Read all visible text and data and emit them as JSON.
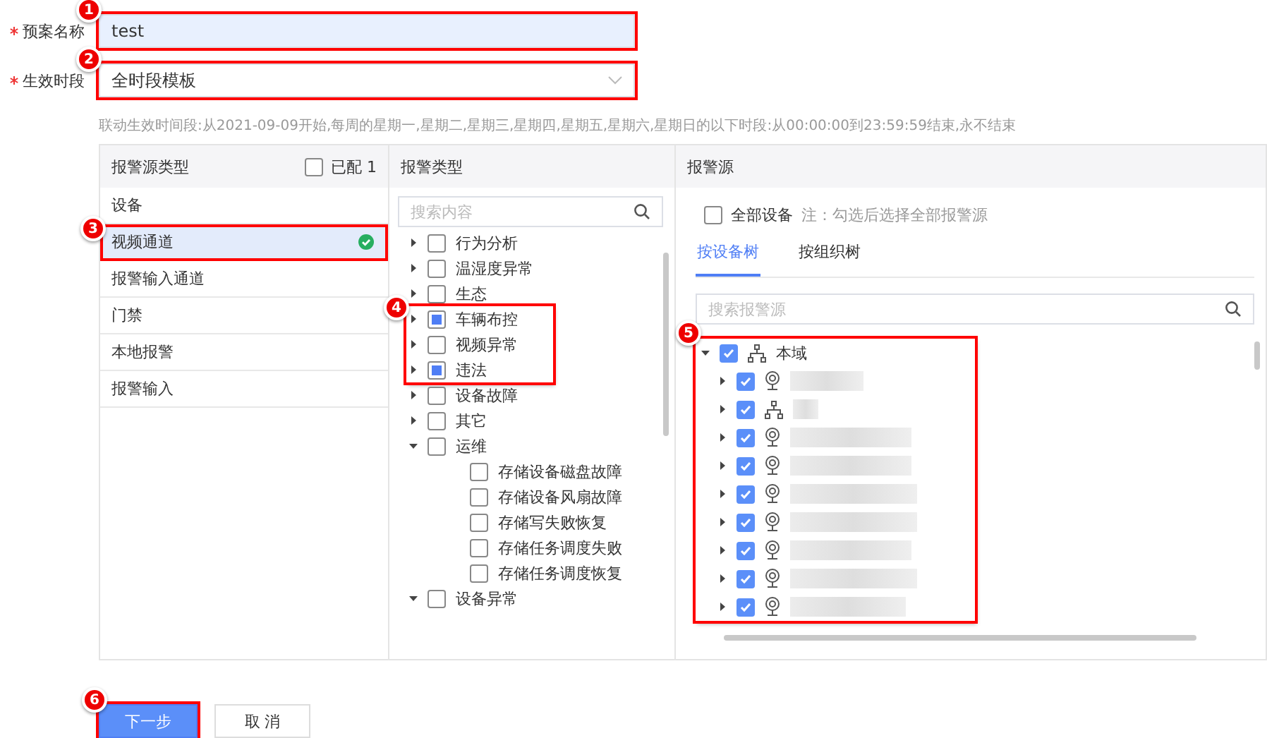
{
  "form": {
    "fields": [
      {
        "label": "预案名称",
        "required": true,
        "kind": "text",
        "value": "test",
        "callout": "1"
      },
      {
        "label": "生效时段",
        "required": true,
        "kind": "select",
        "value": "全时段模板",
        "callout": "2"
      }
    ],
    "hint": "联动生效时间段:从2021-09-09开始,每周的星期一,星期二,星期三,星期四,星期五,星期六,星期日的以下时段:从00:00:00到23:59:59结束,永不结束"
  },
  "source_types": {
    "title": "报警源类型",
    "configured_checked": false,
    "configured_label": "已配 1",
    "items": [
      {
        "label": "设备",
        "selected": false,
        "configured": false
      },
      {
        "label": "视频通道",
        "selected": true,
        "configured": true,
        "callout": "3"
      },
      {
        "label": "报警输入通道",
        "selected": false,
        "configured": false
      },
      {
        "label": "门禁",
        "selected": false,
        "configured": false
      },
      {
        "label": "本地报警",
        "selected": false,
        "configured": false
      },
      {
        "label": "报警输入",
        "selected": false,
        "configured": false
      }
    ]
  },
  "alarm_types": {
    "title": "报警类型",
    "search_placeholder": "搜索内容",
    "callout": "4",
    "items": [
      {
        "label": "行为分析",
        "partial": false,
        "expanded": false,
        "in_callout": false
      },
      {
        "label": "温湿度异常",
        "partial": false,
        "expanded": false,
        "in_callout": false
      },
      {
        "label": "生态",
        "partial": false,
        "expanded": false,
        "in_callout": false
      },
      {
        "label": "车辆布控",
        "partial": true,
        "expanded": false,
        "in_callout": true
      },
      {
        "label": "视频异常",
        "partial": false,
        "expanded": false,
        "in_callout": true
      },
      {
        "label": "违法",
        "partial": true,
        "expanded": false,
        "in_callout": true
      },
      {
        "label": "设备故障",
        "partial": false,
        "expanded": false,
        "in_callout": false
      },
      {
        "label": "其它",
        "partial": false,
        "expanded": false,
        "in_callout": false
      },
      {
        "label": "运维",
        "partial": false,
        "expanded": true,
        "in_callout": false,
        "children": [
          {
            "label": "存储设备磁盘故障",
            "partial": false
          },
          {
            "label": "存储设备风扇故障",
            "partial": false
          },
          {
            "label": "存储写失败恢复",
            "partial": false
          },
          {
            "label": "存储任务调度失败",
            "partial": false
          },
          {
            "label": "存储任务调度恢复",
            "partial": false
          }
        ]
      },
      {
        "label": "设备异常",
        "partial": false,
        "expanded": true,
        "in_callout": false
      }
    ]
  },
  "alarm_sources": {
    "title": "报警源",
    "all_checked": false,
    "all_label": "全部设备",
    "note": "注：勾选后选择全部报警源",
    "tabs": [
      {
        "label": "按设备树",
        "selected": true
      },
      {
        "label": "按组织树",
        "selected": false
      }
    ],
    "search_placeholder": "搜索报警源",
    "callout": "5",
    "tree": {
      "label": "本域",
      "kind": "network",
      "checked": true,
      "expanded": true,
      "children": [
        {
          "kind": "camera",
          "checked": true,
          "expanded": false
        },
        {
          "kind": "network",
          "checked": true,
          "expanded": false
        },
        {
          "kind": "camera",
          "checked": true,
          "expanded": false
        },
        {
          "kind": "camera",
          "checked": true,
          "expanded": false
        },
        {
          "kind": "camera",
          "checked": true,
          "expanded": false
        },
        {
          "kind": "camera",
          "checked": true,
          "expanded": false
        },
        {
          "kind": "camera",
          "checked": true,
          "expanded": false
        },
        {
          "kind": "camera",
          "checked": true,
          "expanded": false
        },
        {
          "kind": "camera",
          "checked": true,
          "expanded": false
        }
      ]
    }
  },
  "buttons": [
    {
      "label": "下一步",
      "kind": "primary",
      "callout": "6"
    },
    {
      "label": "取 消",
      "kind": "default"
    }
  ]
}
